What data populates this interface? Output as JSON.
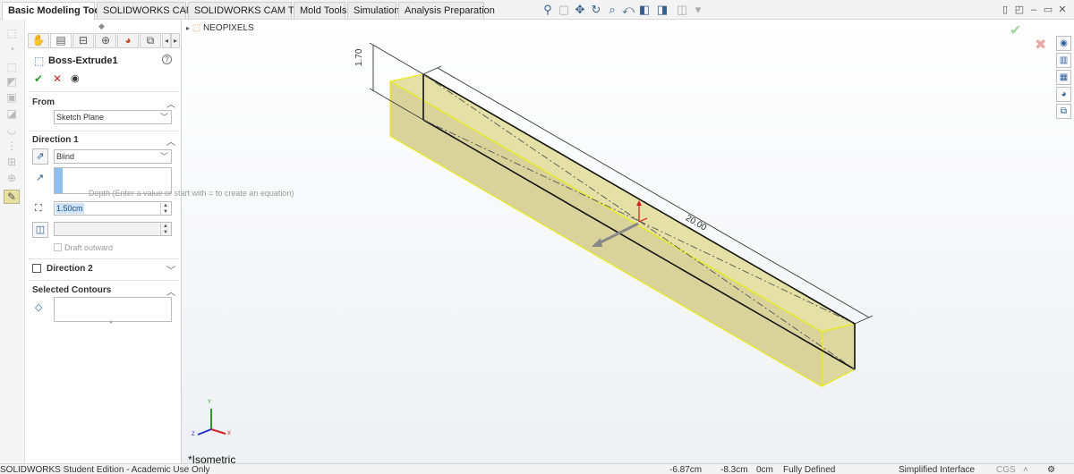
{
  "command_tabs": [
    "Basic Modeling Tools",
    "SOLIDWORKS CAM",
    "SOLIDWORKS CAM TBM",
    "Mold Tools",
    "Simulation",
    "Analysis Preparation"
  ],
  "active_tab": "Basic Modeling Tools",
  "hud_icons": [
    "view-orientation-icon",
    "zoom-to-fit-icon",
    "pan-icon",
    "rotate-icon",
    "zoom-area-icon",
    "previous-view-icon",
    "section-view-icon",
    "display-style-icon",
    "hide-show-icon",
    "scene-icon"
  ],
  "property_manager": {
    "tabs": [
      "feature-manager-icon",
      "property-manager-icon",
      "configuration-manager-icon",
      "dimxpert-icon",
      "display-manager-icon",
      "cam-icon"
    ],
    "feature_title": "Boss-Extrude1",
    "from": {
      "header": "From",
      "value": "Sketch Plane"
    },
    "direction1": {
      "header": "Direction 1",
      "end_condition": "Blind",
      "depth": "1.50cm",
      "draft_outward": "Draft outward"
    },
    "direction2": {
      "header": "Direction 2"
    },
    "selected_contours": {
      "header": "Selected Contours"
    }
  },
  "graphics": {
    "tree_item": "NEOPIXELS",
    "tooltip": "Depth (Enter a value or start with = to create an equation)",
    "dim_height": "1.70",
    "dim_length": "20.00",
    "view_label": "*Isometric",
    "triad": {
      "x": "X",
      "y": "Y",
      "z": "Z"
    }
  },
  "colors": {
    "part_face": "#d9d39b",
    "part_top": "#e4e0a6",
    "part_edge": "#e8ec1a",
    "accent_blue": "#3a5f8a"
  },
  "status_bar": {
    "edition": "SOLIDWORKS Student Edition - Academic Use Only",
    "x": "-6.87cm",
    "y": "-8.3cm",
    "z": "0cm",
    "state": "Fully Defined",
    "interface": "Simplified Interface",
    "units": "CGS"
  }
}
